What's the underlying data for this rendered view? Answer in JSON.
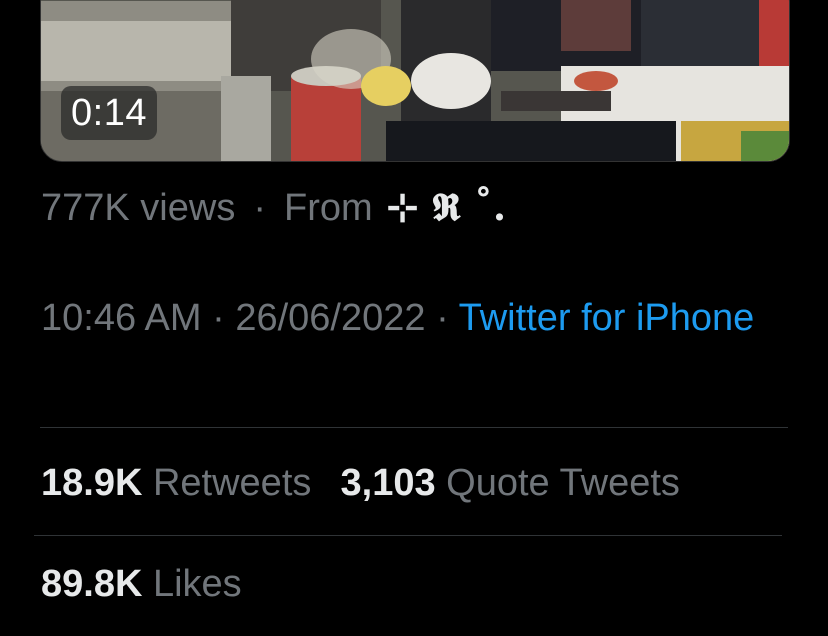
{
  "video": {
    "duration": "0:14"
  },
  "meta": {
    "views": "777K views",
    "separator": "·",
    "from_label": "From",
    "source_name": "⊹ 𝕽 ˚."
  },
  "timestamp": {
    "time": "10:46 AM",
    "separator": "·",
    "date": "26/06/2022",
    "client": "Twitter for iPhone"
  },
  "stats": {
    "retweets_count": "18.9K",
    "retweets_label": "Retweets",
    "quotes_count": "3,103",
    "quotes_label": "Quote Tweets",
    "likes_count": "89.8K",
    "likes_label": "Likes"
  },
  "colors": {
    "background": "#000000",
    "primary_text": "#e7e9ea",
    "secondary_text": "#71767b",
    "link": "#1d9bf0",
    "divider": "#2f3336"
  }
}
